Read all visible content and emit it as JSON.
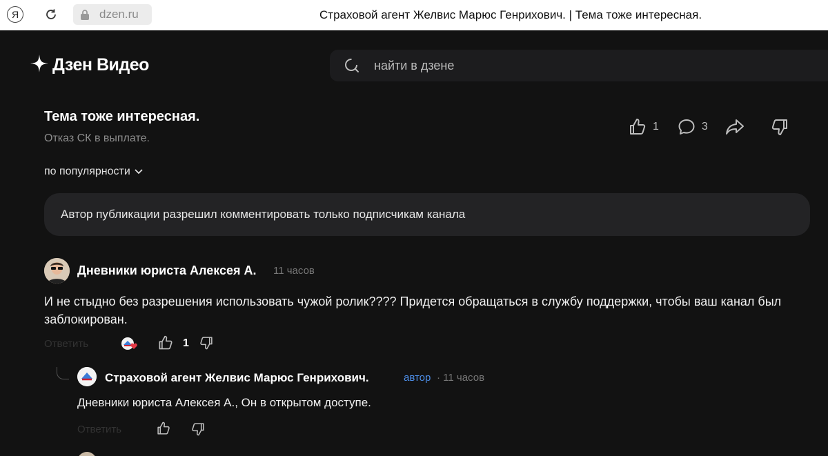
{
  "browser": {
    "logo": "Я",
    "url": "dzen.ru",
    "tab_title": "Страховой агент Желвис Марюс Генрихович. | Тема тоже интересная."
  },
  "header": {
    "logo_text": "Дзен Видео",
    "search_placeholder": "найти в дзене"
  },
  "post": {
    "title": "Тема тоже интересная.",
    "subtitle": "Отказ СК в выплате.",
    "likes": "1",
    "comments": "3"
  },
  "sort": {
    "label": "по популярности"
  },
  "notice": {
    "text": "Автор публикации разрешил комментировать только подписчикам канала"
  },
  "comments": [
    {
      "author": "Дневники юриста Алексея А.",
      "time": "11 часов",
      "text": "И не стыдно без разрешения использовать чужой ролик???? Придется обращаться в службу поддержки, чтобы ваш канал был заблокирован.",
      "reply_label": "Ответить",
      "likes": "1"
    },
    {
      "author": "Страховой агент Желвис Марюс Генрихович.",
      "badge": "автор",
      "time": "· 11 часов",
      "text": "Дневники юриста Алексея А., Он в открытом доступе.",
      "reply_label": "Ответить"
    }
  ],
  "colors": {
    "background": "#121212",
    "surface": "#232325",
    "accent": "#4d8ee8"
  }
}
